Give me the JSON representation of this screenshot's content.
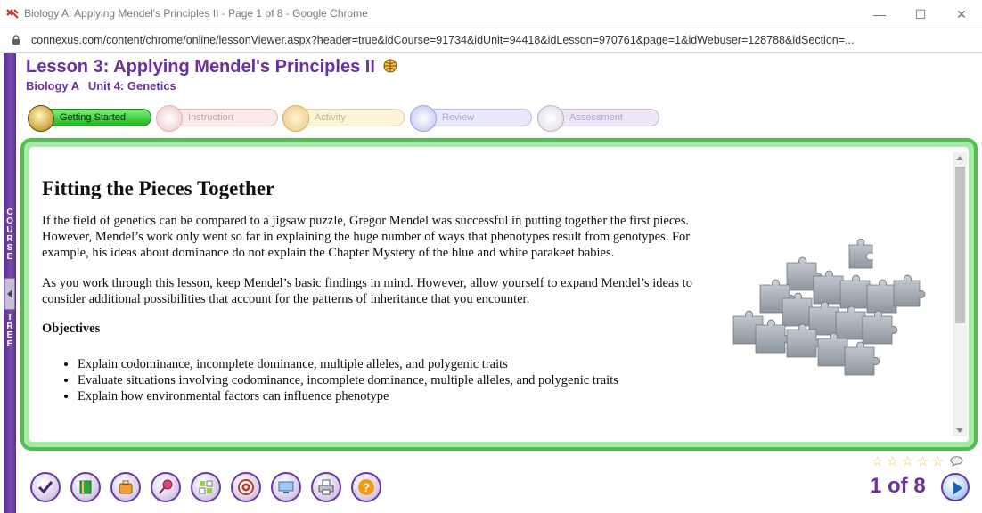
{
  "window": {
    "title": "Biology A: Applying Mendel's Principles II - Page 1 of 8 - Google Chrome",
    "minimize": "—",
    "maximize": "☐",
    "close": "✕"
  },
  "address": {
    "url": "connexus.com/content/chrome/online/lessonViewer.aspx?header=true&idCourse=91734&idUnit=94418&idLesson=970761&page=1&idWebuser=128788&idSection=..."
  },
  "course_tree": {
    "word1": "COURSE",
    "word2": "TREE"
  },
  "lesson": {
    "title": "Lesson 3: Applying Mendel's Principles II",
    "course": "Biology A",
    "unit": "Unit 4: Genetics"
  },
  "tabs": [
    {
      "label": "Getting Started",
      "icon": "traffic-light-icon",
      "state": "active"
    },
    {
      "label": "Instruction",
      "icon": "document-icon",
      "state": "inactive"
    },
    {
      "label": "Activity",
      "icon": "books-icon",
      "state": "inactive"
    },
    {
      "label": "Review",
      "icon": "refresh-icon",
      "state": "inactive"
    },
    {
      "label": "Assessment",
      "icon": "checklist-icon",
      "state": "inactive"
    }
  ],
  "content": {
    "heading": "Fitting the Pieces Together",
    "paragraph1": "If the field of genetics can be compared to a jigsaw puzzle, Gregor Mendel was successful in putting together the first pieces. However, Mendel’s work only went so far in explaining the huge number of ways that phenotypes result from genotypes. For example, his ideas about dominance do not explain the Chapter Mystery of the blue and white parakeet babies.",
    "paragraph2": "As you work through this lesson, keep Mendel’s basic findings in mind. However, allow yourself to expand Mendel’s ideas to consider additional possibilities that account for the patterns of inheritance that you encounter.",
    "objectives_heading": "Objectives",
    "objectives": [
      "Explain codominance, incomplete dominance, multiple alleles, and polygenic traits",
      "Evaluate situations involving codominance, incomplete dominance, multiple alleles, and polygenic traits",
      "Explain how environmental factors can influence phenotype"
    ],
    "image_subject": "puzzle-pieces"
  },
  "toolbar": [
    "checkmark-icon",
    "book-icon",
    "briefcase-icon",
    "pushpin-icon",
    "grid-icon",
    "target-icon",
    "monitor-icon",
    "printer-icon",
    "help-icon"
  ],
  "rating": {
    "stars": 5,
    "filled": 0
  },
  "pager": {
    "text": "1 of 8"
  },
  "colors": {
    "accent": "#6a2fa0",
    "frame": "#4fc04f",
    "active_tab": "#1fb51f"
  }
}
